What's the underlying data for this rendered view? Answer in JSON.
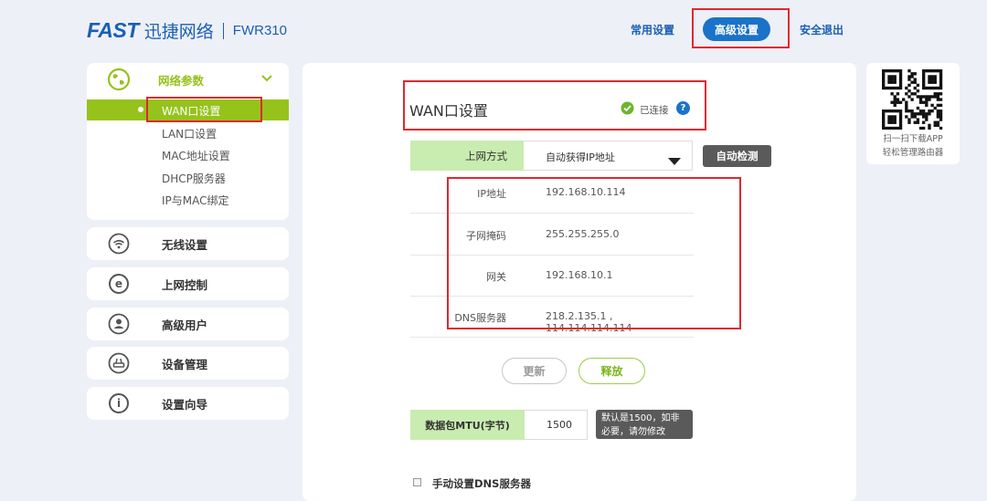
{
  "header": {
    "brand": "FAST",
    "brand_cn": "迅捷网络",
    "model": "FWR310",
    "nav": {
      "common": "常用设置",
      "advanced": "高级设置",
      "logout": "安全退出"
    }
  },
  "sidebar": {
    "network": {
      "title": "网络参数",
      "items": [
        "WAN口设置",
        "LAN口设置",
        "MAC地址设置",
        "DHCP服务器",
        "IP与MAC绑定"
      ]
    },
    "menus": [
      {
        "label": "无线设置",
        "icon": "wifi-icon"
      },
      {
        "label": "上网控制",
        "icon": "internet-e-icon"
      },
      {
        "label": "高级用户",
        "icon": "user-icon"
      },
      {
        "label": "设备管理",
        "icon": "router-icon"
      },
      {
        "label": "设置向导",
        "icon": "info-icon"
      }
    ]
  },
  "main": {
    "title": "WAN口设置",
    "status": "已连接",
    "help": "?",
    "connection": {
      "label": "上网方式",
      "value": "自动获得IP地址",
      "detect_button": "自动检测"
    },
    "info": [
      {
        "label": "IP地址",
        "value": "192.168.10.114"
      },
      {
        "label": "子网掩码",
        "value": "255.255.255.0"
      },
      {
        "label": "网关",
        "value": "192.168.10.1"
      },
      {
        "label": "DNS服务器",
        "value": "218.2.135.1 , 114.114.114.114"
      }
    ],
    "buttons": {
      "renew": "更新",
      "release": "释放"
    },
    "mtu": {
      "label": "数据包MTU(字节)",
      "value": "1500",
      "hint": "默认是1500，如非必要，请勿修改"
    },
    "manual_dns": "手动设置DNS服务器"
  },
  "qr": {
    "caption_line1": "扫一扫下载APP",
    "caption_line2": "轻松管理路由器"
  },
  "colors": {
    "brand_blue": "#1a5fb4",
    "active_green": "#96c21c",
    "label_green": "#c9ecb0",
    "annotation_red": "#e0282e"
  }
}
